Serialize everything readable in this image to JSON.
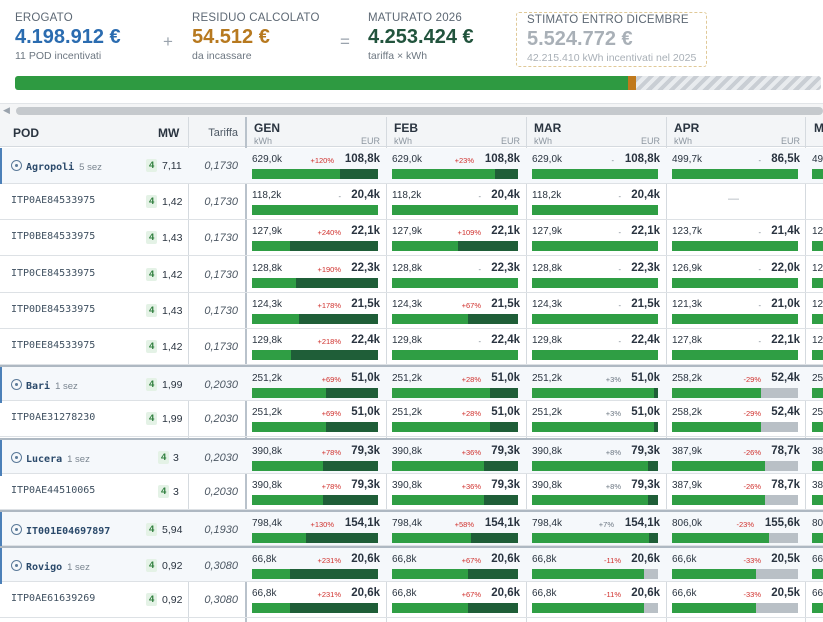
{
  "kpis": {
    "erogato": {
      "label": "EROGATO",
      "value": "4.198.912 €",
      "sub": "11 POD incentivati",
      "color": "#2b6cb0"
    },
    "plus": "+",
    "residuo": {
      "label": "RESIDUO CALCOLATO",
      "value": "54.512 €",
      "sub": "da incassare",
      "color": "#b7791f"
    },
    "equals": "=",
    "maturato": {
      "label": "MATURATO 2026",
      "value": "4.253.424 €",
      "sub": "tariffa × kWh",
      "color": "#22543d"
    },
    "stimato": {
      "label": "STIMATO ENTRO DICEMBRE",
      "value": "5.524.772 €",
      "sub": "42.215.410 kWh incentivati nel 2025"
    }
  },
  "progress": {
    "green_fraction": 0.76,
    "orange_fraction": 0.01,
    "green_color": "#2e9a41",
    "orange_color": "#c0791c"
  },
  "table": {
    "headers": {
      "pod": "POD",
      "mw": "MW",
      "tariffa": "Tariffa",
      "unit_kwh": "kWh",
      "unit_eur": "EUR"
    },
    "months": [
      "GEN",
      "FEB",
      "MAR",
      "APR"
    ],
    "empty_mark": "—",
    "rows": [
      {
        "pod": "Agropoli",
        "sez": "5 sez",
        "group": true,
        "count": "4",
        "mw": "7,11",
        "tariffa": "0,1730",
        "cells": [
          {
            "kwh": "629,0k",
            "pct": "+120%",
            "pct_type": "up",
            "eur": "108,8k",
            "fill": 1.0,
            "tail": 0.3,
            "tail_type": "dk"
          },
          {
            "kwh": "629,0k",
            "pct": "+23%",
            "pct_type": "up",
            "eur": "108,8k",
            "fill": 1.0,
            "tail": 0.18,
            "tail_type": "dk"
          },
          {
            "kwh": "629,0k",
            "pct": "-",
            "pct_type": "neu",
            "eur": "108,8k",
            "fill": 1.0,
            "tail": 0,
            "tail_type": "dk"
          },
          {
            "kwh": "499,7k",
            "pct": "-",
            "pct_type": "neu",
            "eur": "86,5k",
            "fill": 1.0,
            "tail": 0,
            "tail_type": "dk"
          }
        ]
      },
      {
        "pod": "ITP0AE84533975",
        "sez": "",
        "group": false,
        "count": "4",
        "mw": "1,42",
        "tariffa": "0,1730",
        "cells": [
          {
            "kwh": "118,2k",
            "pct": "-",
            "pct_type": "neu",
            "eur": "20,4k",
            "fill": 1.0,
            "tail": 0,
            "tail_type": "dk"
          },
          {
            "kwh": "118,2k",
            "pct": "-",
            "pct_type": "neu",
            "eur": "20,4k",
            "fill": 1.0,
            "tail": 0,
            "tail_type": "dk"
          },
          {
            "kwh": "118,2k",
            "pct": "-",
            "pct_type": "neu",
            "eur": "20,4k",
            "fill": 1.0,
            "tail": 0,
            "tail_type": "dk"
          },
          {
            "empty": true
          }
        ]
      },
      {
        "pod": "ITP0BE84533975",
        "sez": "",
        "group": false,
        "count": "4",
        "mw": "1,43",
        "tariffa": "0,1730",
        "cells": [
          {
            "kwh": "127,9k",
            "pct": "+240%",
            "pct_type": "up",
            "eur": "22,1k",
            "fill": 1.0,
            "tail": 0.7,
            "tail_type": "dk"
          },
          {
            "kwh": "127,9k",
            "pct": "+109%",
            "pct_type": "up",
            "eur": "22,1k",
            "fill": 1.0,
            "tail": 0.48,
            "tail_type": "dk"
          },
          {
            "kwh": "127,9k",
            "pct": "-",
            "pct_type": "neu",
            "eur": "22,1k",
            "fill": 1.0,
            "tail": 0,
            "tail_type": "dk"
          },
          {
            "kwh": "123,7k",
            "pct": "-",
            "pct_type": "neu",
            "eur": "21,4k",
            "fill": 1.0,
            "tail": 0,
            "tail_type": "dk"
          }
        ]
      },
      {
        "pod": "ITP0CE84533975",
        "sez": "",
        "group": false,
        "count": "4",
        "mw": "1,42",
        "tariffa": "0,1730",
        "cells": [
          {
            "kwh": "128,8k",
            "pct": "+190%",
            "pct_type": "up",
            "eur": "22,3k",
            "fill": 1.0,
            "tail": 0.65,
            "tail_type": "dk"
          },
          {
            "kwh": "128,8k",
            "pct": "-",
            "pct_type": "neu",
            "eur": "22,3k",
            "fill": 1.0,
            "tail": 0,
            "tail_type": "dk"
          },
          {
            "kwh": "128,8k",
            "pct": "-",
            "pct_type": "neu",
            "eur": "22,3k",
            "fill": 1.0,
            "tail": 0,
            "tail_type": "dk"
          },
          {
            "kwh": "126,9k",
            "pct": "-",
            "pct_type": "neu",
            "eur": "22,0k",
            "fill": 1.0,
            "tail": 0,
            "tail_type": "dk"
          }
        ]
      },
      {
        "pod": "ITP0DE84533975",
        "sez": "",
        "group": false,
        "count": "4",
        "mw": "1,43",
        "tariffa": "0,1730",
        "cells": [
          {
            "kwh": "124,3k",
            "pct": "+178%",
            "pct_type": "up",
            "eur": "21,5k",
            "fill": 1.0,
            "tail": 0.63,
            "tail_type": "dk"
          },
          {
            "kwh": "124,3k",
            "pct": "+67%",
            "pct_type": "up",
            "eur": "21,5k",
            "fill": 1.0,
            "tail": 0.4,
            "tail_type": "dk"
          },
          {
            "kwh": "124,3k",
            "pct": "-",
            "pct_type": "neu",
            "eur": "21,5k",
            "fill": 1.0,
            "tail": 0,
            "tail_type": "dk"
          },
          {
            "kwh": "121,3k",
            "pct": "-",
            "pct_type": "neu",
            "eur": "21,0k",
            "fill": 1.0,
            "tail": 0,
            "tail_type": "dk"
          }
        ]
      },
      {
        "pod": "ITP0EE84533975",
        "sez": "",
        "group": false,
        "count": "4",
        "mw": "1,42",
        "tariffa": "0,1730",
        "cells": [
          {
            "kwh": "129,8k",
            "pct": "+218%",
            "pct_type": "up",
            "eur": "22,4k",
            "fill": 1.0,
            "tail": 0.69,
            "tail_type": "dk"
          },
          {
            "kwh": "129,8k",
            "pct": "-",
            "pct_type": "neu",
            "eur": "22,4k",
            "fill": 1.0,
            "tail": 0,
            "tail_type": "dk"
          },
          {
            "kwh": "129,8k",
            "pct": "-",
            "pct_type": "neu",
            "eur": "22,4k",
            "fill": 1.0,
            "tail": 0,
            "tail_type": "dk"
          },
          {
            "kwh": "127,8k",
            "pct": "-",
            "pct_type": "neu",
            "eur": "22,1k",
            "fill": 1.0,
            "tail": 0,
            "tail_type": "dk"
          }
        ]
      },
      {
        "pod": "Bari",
        "sez": "1 sez",
        "group": true,
        "sep": true,
        "count": "4",
        "mw": "1,99",
        "tariffa": "0,2030",
        "cells": [
          {
            "kwh": "251,2k",
            "pct": "+69%",
            "pct_type": "up",
            "eur": "51,0k",
            "fill": 1.0,
            "tail": 0.41,
            "tail_type": "dk"
          },
          {
            "kwh": "251,2k",
            "pct": "+28%",
            "pct_type": "up",
            "eur": "51,0k",
            "fill": 1.0,
            "tail": 0.22,
            "tail_type": "dk"
          },
          {
            "kwh": "251,2k",
            "pct": "+3%",
            "pct_type": "neu",
            "eur": "51,0k",
            "fill": 1.0,
            "tail": 0.03,
            "tail_type": "dk"
          },
          {
            "kwh": "258,2k",
            "pct": "-29%",
            "pct_type": "dn",
            "eur": "52,4k",
            "fill": 1.0,
            "tail": 0.29,
            "tail_type": "gy"
          }
        ]
      },
      {
        "pod": "ITP0AE31278230",
        "sez": "",
        "group": false,
        "count": "4",
        "mw": "1,99",
        "tariffa": "0,2030",
        "cells": [
          {
            "kwh": "251,2k",
            "pct": "+69%",
            "pct_type": "up",
            "eur": "51,0k",
            "fill": 1.0,
            "tail": 0.41,
            "tail_type": "dk"
          },
          {
            "kwh": "251,2k",
            "pct": "+28%",
            "pct_type": "up",
            "eur": "51,0k",
            "fill": 1.0,
            "tail": 0.22,
            "tail_type": "dk"
          },
          {
            "kwh": "251,2k",
            "pct": "+3%",
            "pct_type": "neu",
            "eur": "51,0k",
            "fill": 1.0,
            "tail": 0.03,
            "tail_type": "dk"
          },
          {
            "kwh": "258,2k",
            "pct": "-29%",
            "pct_type": "dn",
            "eur": "52,4k",
            "fill": 1.0,
            "tail": 0.29,
            "tail_type": "gy"
          }
        ]
      },
      {
        "pod": "Lucera",
        "sez": "1 sez",
        "group": true,
        "sep": true,
        "count": "4",
        "mw": "3",
        "tariffa": "0,2030",
        "cells": [
          {
            "kwh": "390,8k",
            "pct": "+78%",
            "pct_type": "up",
            "eur": "79,3k",
            "fill": 1.0,
            "tail": 0.44,
            "tail_type": "dk"
          },
          {
            "kwh": "390,8k",
            "pct": "+36%",
            "pct_type": "up",
            "eur": "79,3k",
            "fill": 1.0,
            "tail": 0.27,
            "tail_type": "dk"
          },
          {
            "kwh": "390,8k",
            "pct": "+8%",
            "pct_type": "neu",
            "eur": "79,3k",
            "fill": 1.0,
            "tail": 0.08,
            "tail_type": "dk"
          },
          {
            "kwh": "387,9k",
            "pct": "-26%",
            "pct_type": "dn",
            "eur": "78,7k",
            "fill": 1.0,
            "tail": 0.26,
            "tail_type": "gy"
          }
        ]
      },
      {
        "pod": "ITP0AE44510065",
        "sez": "",
        "group": false,
        "count": "4",
        "mw": "3",
        "tariffa": "0,2030",
        "cells": [
          {
            "kwh": "390,8k",
            "pct": "+78%",
            "pct_type": "up",
            "eur": "79,3k",
            "fill": 1.0,
            "tail": 0.44,
            "tail_type": "dk"
          },
          {
            "kwh": "390,8k",
            "pct": "+36%",
            "pct_type": "up",
            "eur": "79,3k",
            "fill": 1.0,
            "tail": 0.27,
            "tail_type": "dk"
          },
          {
            "kwh": "390,8k",
            "pct": "+8%",
            "pct_type": "neu",
            "eur": "79,3k",
            "fill": 1.0,
            "tail": 0.08,
            "tail_type": "dk"
          },
          {
            "kwh": "387,9k",
            "pct": "-26%",
            "pct_type": "dn",
            "eur": "78,7k",
            "fill": 1.0,
            "tail": 0.26,
            "tail_type": "gy"
          }
        ]
      },
      {
        "pod": "IT001E04697897",
        "sez": "",
        "group": true,
        "sep": true,
        "count": "4",
        "mw": "5,94",
        "tariffa": "0,1930",
        "cells": [
          {
            "kwh": "798,4k",
            "pct": "+130%",
            "pct_type": "up",
            "eur": "154,1k",
            "fill": 1.0,
            "tail": 0.57,
            "tail_type": "dk"
          },
          {
            "kwh": "798,4k",
            "pct": "+58%",
            "pct_type": "up",
            "eur": "154,1k",
            "fill": 1.0,
            "tail": 0.37,
            "tail_type": "dk"
          },
          {
            "kwh": "798,4k",
            "pct": "+7%",
            "pct_type": "neu",
            "eur": "154,1k",
            "fill": 1.0,
            "tail": 0.07,
            "tail_type": "dk"
          },
          {
            "kwh": "806,0k",
            "pct": "-23%",
            "pct_type": "dn",
            "eur": "155,6k",
            "fill": 1.0,
            "tail": 0.23,
            "tail_type": "gy"
          }
        ]
      },
      {
        "pod": "Rovigo",
        "sez": "1 sez",
        "group": true,
        "sep": true,
        "count": "4",
        "mw": "0,92",
        "tariffa": "0,3080",
        "cells": [
          {
            "kwh": "66,8k",
            "pct": "+231%",
            "pct_type": "up",
            "eur": "20,6k",
            "fill": 1.0,
            "tail": 0.7,
            "tail_type": "dk"
          },
          {
            "kwh": "66,8k",
            "pct": "+67%",
            "pct_type": "up",
            "eur": "20,6k",
            "fill": 1.0,
            "tail": 0.4,
            "tail_type": "dk"
          },
          {
            "kwh": "66,8k",
            "pct": "-11%",
            "pct_type": "dn",
            "eur": "20,6k",
            "fill": 1.0,
            "tail": 0.11,
            "tail_type": "gy"
          },
          {
            "kwh": "66,6k",
            "pct": "-33%",
            "pct_type": "dn",
            "eur": "20,5k",
            "fill": 1.0,
            "tail": 0.33,
            "tail_type": "gy"
          }
        ]
      },
      {
        "pod": "ITP0AE61639269",
        "sez": "",
        "group": false,
        "count": "4",
        "mw": "0,92",
        "tariffa": "0,3080",
        "cells": [
          {
            "kwh": "66,8k",
            "pct": "+231%",
            "pct_type": "up",
            "eur": "20,6k",
            "fill": 1.0,
            "tail": 0.7,
            "tail_type": "dk"
          },
          {
            "kwh": "66,8k",
            "pct": "+67%",
            "pct_type": "up",
            "eur": "20,6k",
            "fill": 1.0,
            "tail": 0.4,
            "tail_type": "dk"
          },
          {
            "kwh": "66,8k",
            "pct": "-11%",
            "pct_type": "dn",
            "eur": "20,6k",
            "fill": 1.0,
            "tail": 0.11,
            "tail_type": "gy"
          },
          {
            "kwh": "66,6k",
            "pct": "-33%",
            "pct_type": "dn",
            "eur": "20,5k",
            "fill": 1.0,
            "tail": 0.33,
            "tail_type": "gy"
          }
        ]
      }
    ],
    "partial_column_label": "M",
    "partial_values": [
      "49",
      "",
      "12",
      "12",
      "12",
      "12",
      "25",
      "25",
      "38",
      "38",
      "80",
      "66",
      "66"
    ]
  },
  "icons": {
    "group": "solar-icon",
    "scroll_left": "triangle-left-icon"
  }
}
